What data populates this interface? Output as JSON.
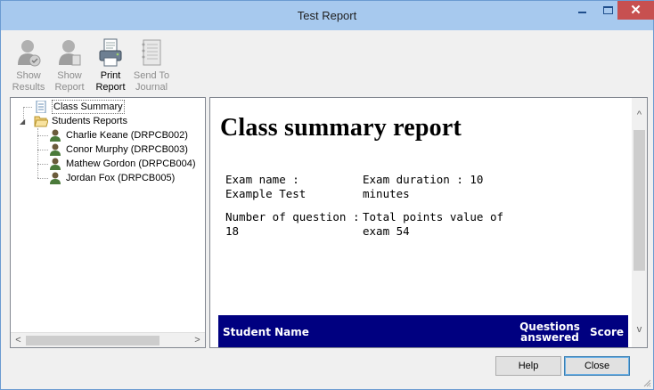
{
  "window": {
    "title": "Test Report"
  },
  "toolbar": {
    "items": [
      {
        "label_line1": "Show",
        "label_line2": "Results",
        "enabled": false,
        "icon": "user-check-icon"
      },
      {
        "label_line1": "Show",
        "label_line2": "Report",
        "enabled": false,
        "icon": "user-report-icon"
      },
      {
        "label_line1": "Print",
        "label_line2": "Report",
        "enabled": true,
        "icon": "printer-icon"
      },
      {
        "label_line1": "Send To",
        "label_line2": "Journal",
        "enabled": false,
        "icon": "journal-icon"
      }
    ]
  },
  "tree": {
    "class_summary": "Class Summary",
    "students_reports": "Students Reports",
    "students": [
      "Charlie Keane (DRPCB002)",
      "Conor Murphy (DRPCB003)",
      "Mathew Gordon (DRPCB004)",
      "Jordan Fox (DRPCB005)"
    ]
  },
  "report": {
    "title": "Class summary report",
    "exam_name_label": "Exam name :",
    "exam_name_value": "Example Test",
    "exam_duration_line1": "Exam duration : 10",
    "exam_duration_line2": "minutes",
    "num_questions_line1": "Number of question :",
    "num_questions_line2": "18",
    "total_points_line1": "Total points value of",
    "total_points_line2": "exam 54",
    "table_headers": {
      "student_name": "Student Name",
      "questions_line1": "Questions",
      "questions_line2": "answered",
      "score": "Score"
    },
    "header_color": "#000080"
  },
  "buttons": {
    "help": "Help",
    "close": "Close"
  }
}
